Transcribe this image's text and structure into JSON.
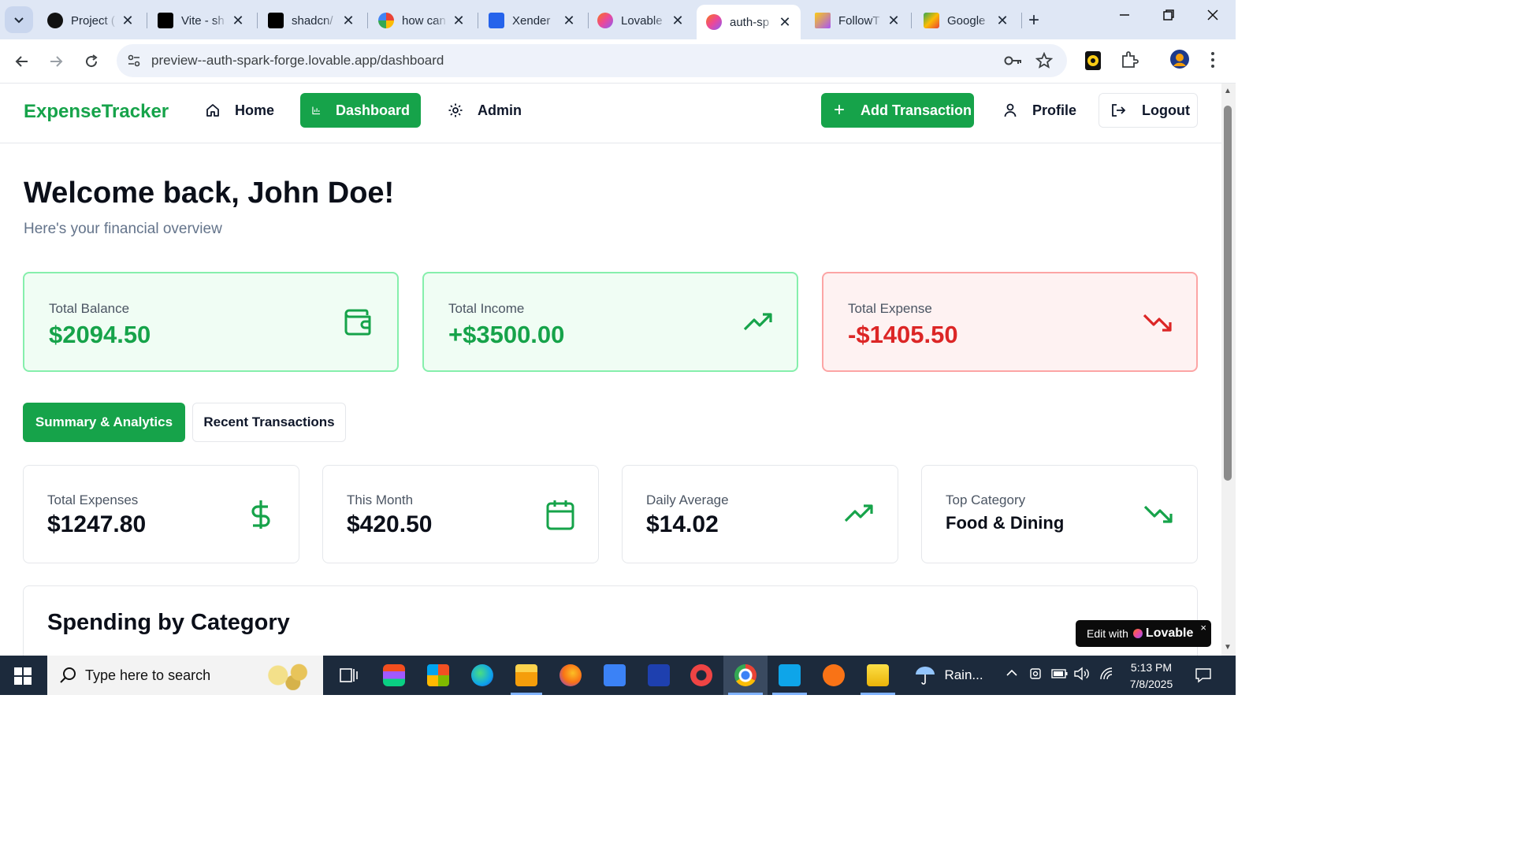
{
  "browser": {
    "tabs": [
      {
        "label": "Project (",
        "color": "#0f172a"
      },
      {
        "label": "Vite - sh",
        "color": "#000000"
      },
      {
        "label": "shadcn/",
        "color": "#000000"
      },
      {
        "label": "how can",
        "color": "#4285f4"
      },
      {
        "label": "Xender",
        "color": "#2563eb"
      },
      {
        "label": "Lovable",
        "color": "#ec4899"
      },
      {
        "label": "auth-sp",
        "color": "#ec4899"
      },
      {
        "label": "FollowT",
        "color": "#a855f7"
      },
      {
        "label": "Google",
        "color": "#0f9d58"
      }
    ],
    "url": "preview--auth-spark-forge.lovable.app/dashboard"
  },
  "nav": {
    "brand": "ExpenseTracker",
    "items": [
      {
        "label": "Home",
        "icon": "home-icon"
      },
      {
        "label": "Dashboard",
        "icon": "bar-chart-icon"
      },
      {
        "label": "Admin",
        "icon": "gear-icon"
      }
    ],
    "add_transaction": "Add Transaction",
    "profile": "Profile",
    "logout": "Logout"
  },
  "header": {
    "welcome": "Welcome back, John Doe!",
    "subtitle": "Here's your financial overview"
  },
  "stats": [
    {
      "label": "Total Balance",
      "value": "$2094.50",
      "icon": "wallet-icon",
      "tone": "green"
    },
    {
      "label": "Total Income",
      "value": "+$3500.00",
      "icon": "trending-up-icon",
      "tone": "green"
    },
    {
      "label": "Total Expense",
      "value": "-$1405.50",
      "icon": "trending-down-icon",
      "tone": "red"
    }
  ],
  "tabs": {
    "summary": "Summary & Analytics",
    "recent": "Recent Transactions"
  },
  "metrics": [
    {
      "label": "Total Expenses",
      "value": "$1247.80",
      "icon": "dollar-icon"
    },
    {
      "label": "This Month",
      "value": "$420.50",
      "icon": "calendar-icon"
    },
    {
      "label": "Daily Average",
      "value": "$14.02",
      "icon": "trending-up-icon"
    },
    {
      "label": "Top Category",
      "value": "Food & Dining",
      "icon": "trending-down-icon"
    }
  ],
  "spending": {
    "title": "Spending by Category"
  },
  "badge": {
    "prefix": "Edit with",
    "brand": "Lovable",
    "close": "×"
  },
  "taskbar": {
    "search_placeholder": "Type here to search",
    "weather": "Rain...",
    "time": "5:13 PM",
    "date": "7/8/2025"
  },
  "colors": {
    "accent": "#16a34a",
    "danger": "#dc2626"
  }
}
